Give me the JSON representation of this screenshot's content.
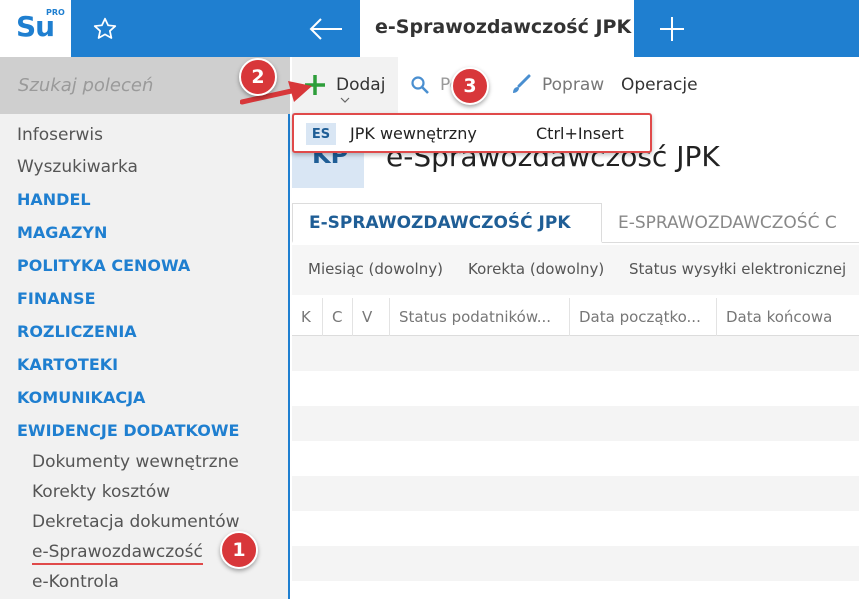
{
  "app": {
    "logo_text": "Su",
    "logo_superscript": "PRO",
    "brand_color": "#1f7fd0",
    "active_tab_title": "e-Sprawozdawczość JPK"
  },
  "sidebar": {
    "search_placeholder": "Szukaj poleceń",
    "items": [
      {
        "label": "Infoserwis",
        "type": "item"
      },
      {
        "label": "Wyszukiwarka",
        "type": "item"
      },
      {
        "label": "HANDEL",
        "type": "section"
      },
      {
        "label": "MAGAZYN",
        "type": "section"
      },
      {
        "label": "POLITYKA CENOWA",
        "type": "section"
      },
      {
        "label": "FINANSE",
        "type": "section"
      },
      {
        "label": "ROZLICZENIA",
        "type": "section"
      },
      {
        "label": "KARTOTEKI",
        "type": "section"
      },
      {
        "label": "KOMUNIKACJA",
        "type": "section"
      },
      {
        "label": "EWIDENCJE DODATKOWE",
        "type": "section"
      },
      {
        "label": "Dokumenty wewnętrzne",
        "type": "sub"
      },
      {
        "label": "Korekty kosztów",
        "type": "sub"
      },
      {
        "label": "Dekretacja dokumentów",
        "type": "sub"
      },
      {
        "label": "e-Sprawozdawczość",
        "type": "sub",
        "active": true
      },
      {
        "label": "e-Kontrola",
        "type": "sub"
      }
    ]
  },
  "toolbar": {
    "add_label": "Dodaj",
    "show_label": "Pokaż",
    "edit_label": "Popraw",
    "operations_label": "Operacje"
  },
  "dropdown": {
    "badge": "ES",
    "label": "JPK wewnętrzny",
    "shortcut": "Ctrl+Insert"
  },
  "main": {
    "badge": "KP",
    "title": "e-Sprawozdawczość JPK",
    "tabs": [
      "E-SPRAWOZDAWCZOŚĆ JPK",
      "E-SPRAWOZDAWCZOŚĆ C"
    ],
    "filters": [
      "Miesiąc (dowolny)",
      "Korekta (dowolny)",
      "Status wysyłki elektronicznej"
    ],
    "columns": [
      "K",
      "C",
      "V",
      "Status podatników...",
      "Data początko...",
      "Data końcowa"
    ]
  },
  "annotations": {
    "marker_1": "1",
    "marker_2": "2",
    "marker_3": "3",
    "marker_color": "#d8373a"
  }
}
